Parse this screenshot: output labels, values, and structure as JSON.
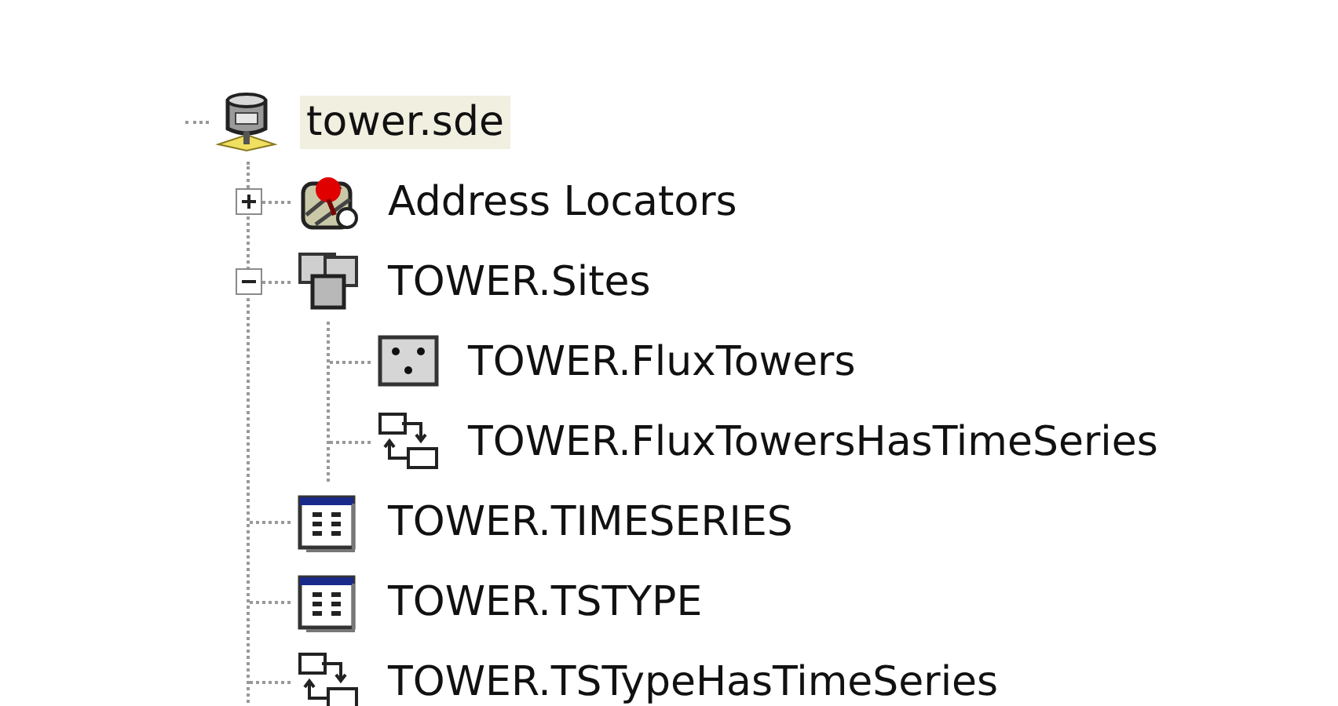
{
  "tree": [
    {
      "label": "tower.sde",
      "kind": "database",
      "selected": true,
      "children": [
        {
          "label": "Address Locators",
          "kind": "locators",
          "selected": false,
          "expanded": false
        },
        {
          "label": "TOWER.Sites",
          "kind": "dataset",
          "selected": false,
          "expanded": true,
          "children": [
            {
              "label": "TOWER.FluxTowers",
              "kind": "featureclass",
              "selected": false
            },
            {
              "label": "TOWER.FluxTowersHasTimeSeries",
              "kind": "relationship",
              "selected": false
            }
          ]
        },
        {
          "label": "TOWER.TIMESERIES",
          "kind": "table",
          "selected": false
        },
        {
          "label": "TOWER.TSTYPE",
          "kind": "table",
          "selected": false
        },
        {
          "label": "TOWER.TSTypeHasTimeSeries",
          "kind": "relationship",
          "selected": false
        }
      ]
    }
  ]
}
